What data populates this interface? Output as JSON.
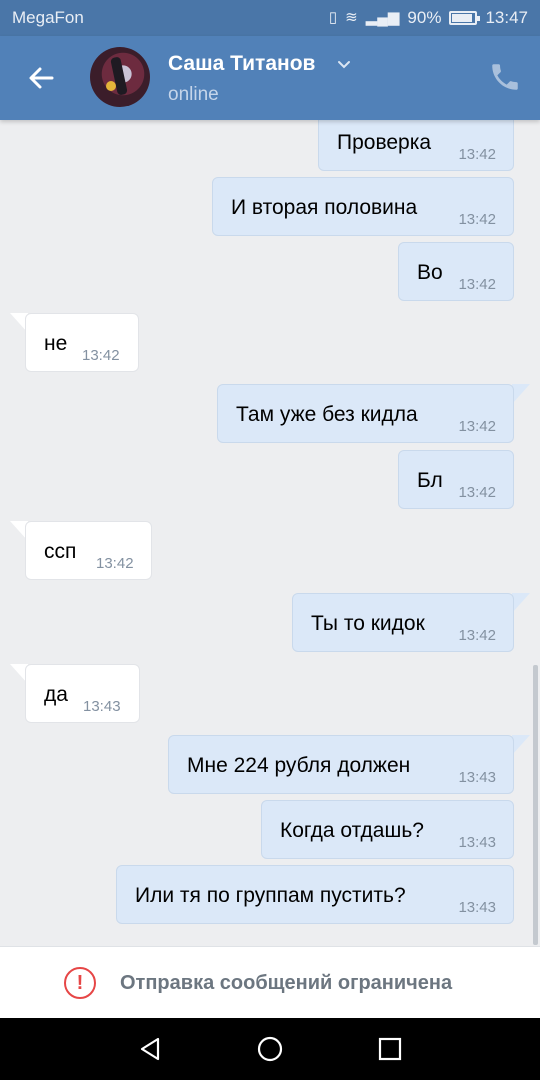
{
  "status_bar": {
    "carrier": "MegaFon",
    "battery": "90%",
    "battery_level": 0.9,
    "time": "13:47"
  },
  "header": {
    "name": "Саша Титанов",
    "status": "online"
  },
  "messages": [
    {
      "text": "Проверка",
      "time": "13:42",
      "dir": "out"
    },
    {
      "text": "И вторая половина",
      "time": "13:42",
      "dir": "out"
    },
    {
      "text": "Во",
      "time": "13:42",
      "dir": "out"
    },
    {
      "text": "не",
      "time": "13:42",
      "dir": "in"
    },
    {
      "text": "Там уже без кидла",
      "time": "13:42",
      "dir": "out"
    },
    {
      "text": "Бл",
      "time": "13:42",
      "dir": "out"
    },
    {
      "text": "ссп",
      "time": "13:42",
      "dir": "in"
    },
    {
      "text": "Ты то кидок",
      "time": "13:42",
      "dir": "out"
    },
    {
      "text": "да",
      "time": "13:43",
      "dir": "in"
    },
    {
      "text": "Мне 224 рубля должен",
      "time": "13:43",
      "dir": "out"
    },
    {
      "text": "Когда отдашь?",
      "time": "13:43",
      "dir": "out"
    },
    {
      "text": "Или тя по группам пустить?",
      "time": "13:43",
      "dir": "out"
    }
  ],
  "restriction": {
    "icon": "!",
    "text": "Отправка сообщений ограничена",
    "color": "#e64646"
  },
  "colors": {
    "header": "#5181b8",
    "status_bar": "#4a76a8",
    "outgoing_bubble": "#dbe8f8",
    "incoming_bubble": "#ffffff",
    "background": "#edeef0"
  },
  "icons": {
    "back": "arrow-left-icon",
    "dropdown": "chevron-down-icon",
    "call": "phone-icon",
    "nav_back": "triangle-back-icon",
    "nav_home": "circle-home-icon",
    "nav_recent": "square-recent-icon"
  }
}
